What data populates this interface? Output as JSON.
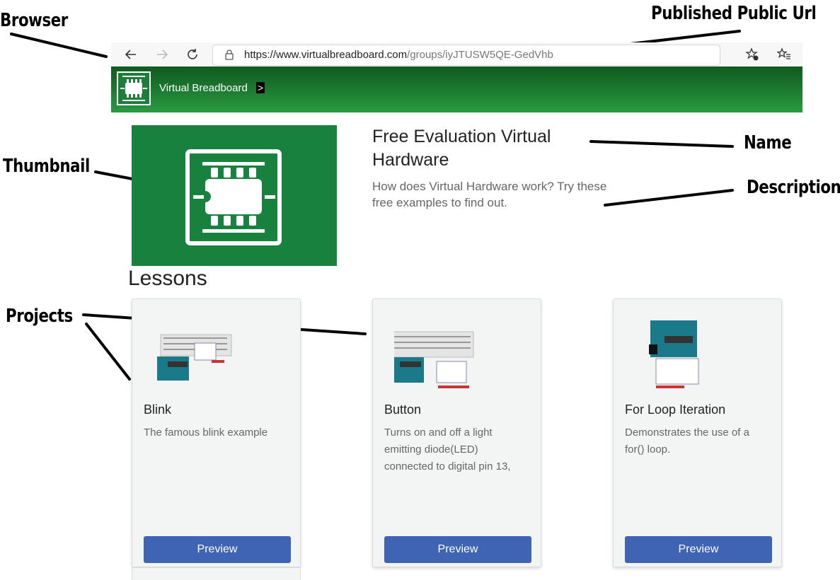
{
  "annotations": {
    "browser": "Browser",
    "published_url": "Published Public Url",
    "thumbnail": "Thumbnail",
    "name": "Name",
    "description": "Description",
    "projects": "Projects"
  },
  "browser": {
    "back_icon": "arrow-left-icon",
    "forward_icon": "arrow-right-icon",
    "reload_icon": "reload-icon",
    "url_host": "https://www.virtualbreadboard.com",
    "url_path": "/groups/iyJTUSW5QE-GedVhb",
    "favorite_add_icon": "star-plus-icon",
    "favorites_icon": "favorites-list-icon"
  },
  "site": {
    "name": "Virtual Breadboard",
    "chevron": ">",
    "header_color": "#1f7f35"
  },
  "group": {
    "name": "Free Evaluation Virtual Hardware",
    "description": "How does Virtual Hardware work? Try these free examples to find out.",
    "thumbnail_color": "#18813d"
  },
  "section_title": "Lessons",
  "projects": [
    {
      "title": "Blink",
      "description": "The famous blink example",
      "button": "Preview"
    },
    {
      "title": "Button",
      "description": "Turns on and off a light emitting diode(LED) connected to digital pin 13,",
      "button": "Preview"
    },
    {
      "title": "For Loop Iteration",
      "description": "Demonstrates the use of a for() loop.",
      "button": "Preview"
    }
  ],
  "accent_color": "#3e64b3"
}
